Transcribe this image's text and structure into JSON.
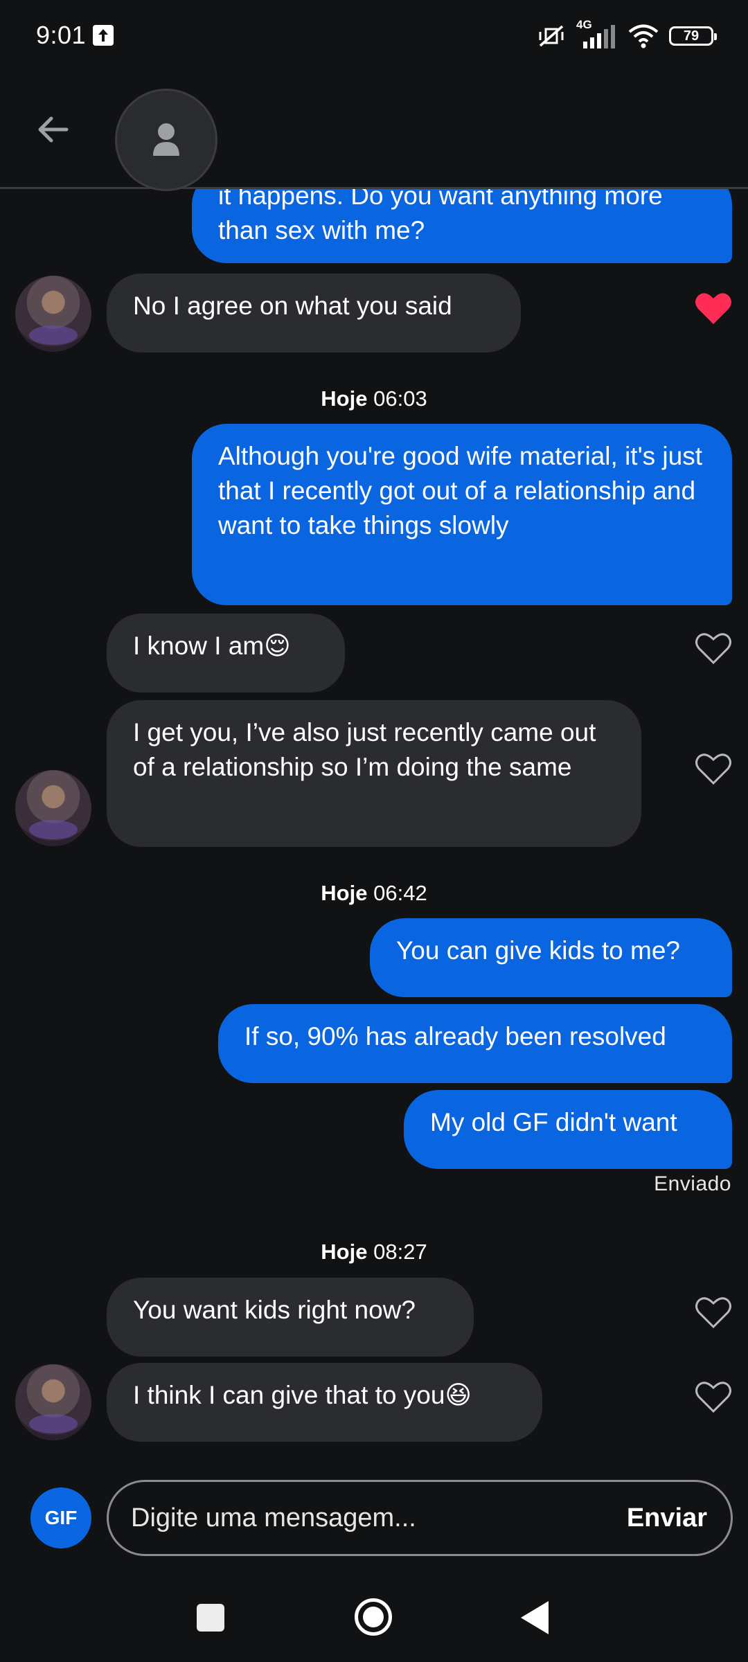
{
  "status_bar": {
    "time": "9:01",
    "network": "4G",
    "battery": "79"
  },
  "header": {
    "back_icon": "arrow-left-icon",
    "avatar_icon": "person-icon"
  },
  "messages": [
    {
      "type": "sent",
      "text": "it happens. Do you want anything more than sex with me?"
    },
    {
      "type": "received",
      "text": "No I agree on what you said",
      "liked": true
    },
    {
      "type": "timestamp",
      "day": "Hoje",
      "time": "06:03"
    },
    {
      "type": "sent",
      "text": "Although you're good wife material, it's just that I recently got out of a relationship and want to take things slowly"
    },
    {
      "type": "received",
      "text": "I know I am😌",
      "liked": false
    },
    {
      "type": "received",
      "text": "I get you, I’ve also just recently came out of a relationship so I’m doing the same",
      "liked": false
    },
    {
      "type": "timestamp",
      "day": "Hoje",
      "time": "06:42"
    },
    {
      "type": "sent",
      "text": "You can give kids to me?"
    },
    {
      "type": "sent",
      "text": "If so, 90% has already been resolved"
    },
    {
      "type": "sent",
      "text": "My old GF didn't want"
    },
    {
      "type": "status",
      "text": "Enviado"
    },
    {
      "type": "timestamp",
      "day": "Hoje",
      "time": "08:27"
    },
    {
      "type": "received",
      "text": "You want kids right now?",
      "liked": false
    },
    {
      "type": "received",
      "text": "I think I can give that to you😆",
      "liked": false
    }
  ],
  "composer": {
    "gif_label": "GIF",
    "placeholder": "Digite uma mensagem...",
    "send_label": "Enviar"
  },
  "colors": {
    "background": "#111214",
    "sent_bubble": "#0a66e0",
    "received_bubble": "#2b2c30",
    "heart_liked": "#ff2d55"
  }
}
